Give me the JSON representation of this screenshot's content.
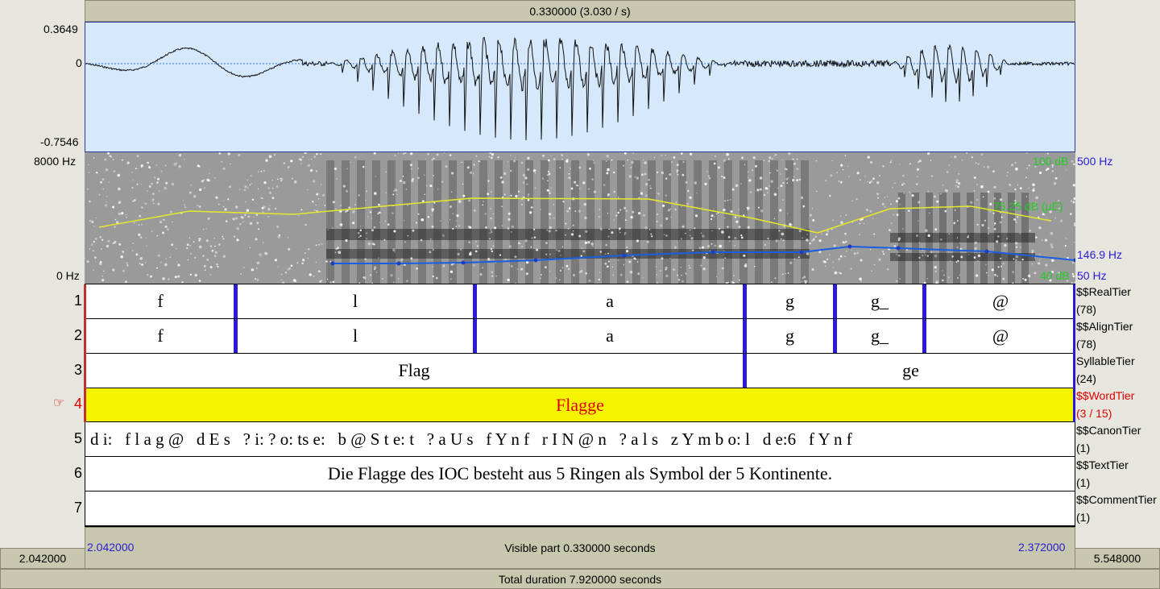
{
  "top_bar": {
    "label": "0.330000 (3.030 / s)"
  },
  "waveform": {
    "max": "0.3649",
    "zero": "0",
    "min": "-0.7546"
  },
  "spectrogram": {
    "freq_top": "8000 Hz",
    "freq_bottom": "0 Hz",
    "intensity_top": "100 dB",
    "intensity_cursor": "75.25 dB (μE)",
    "intensity_bottom": "40 dB",
    "pitch_top": "500 Hz",
    "pitch_cursor": "146.9 Hz",
    "pitch_bottom": "50 Hz"
  },
  "tiers": [
    {
      "num": "1",
      "name": "$$RealTier",
      "count": "(78)",
      "segments": [
        "f",
        "l",
        "a",
        "g",
        "g_",
        "@"
      ]
    },
    {
      "num": "2",
      "name": "$$AlignTier",
      "count": "(78)",
      "segments": [
        "f",
        "l",
        "a",
        "g",
        "g_",
        "@"
      ]
    },
    {
      "num": "3",
      "name": "SyllableTier",
      "count": "(24)",
      "segments": [
        "Flag",
        "ge"
      ]
    },
    {
      "num": "4",
      "pointer": "☞",
      "name": "$$WordTier",
      "count": "(3 / 15)",
      "segments": [
        "Flagge"
      ]
    },
    {
      "num": "5",
      "name": "$$CanonTier",
      "count": "(1)",
      "text": "d i:   f l a g @   d E s   ? i: ? o: ts e:   b @ S t e: t   ? a U s   f Y n f   r I N @ n   ? a l s   z Y m b o: l   d e:6   f Y n f"
    },
    {
      "num": "6",
      "name": "$$TextTier",
      "count": "(1)",
      "text": "Die Flagge des IOC besteht aus 5 Ringen als Symbol der 5 Kontinente."
    },
    {
      "num": "7",
      "name": "$$CommentTier",
      "count": "(1)",
      "text": ""
    }
  ],
  "bottom": {
    "visible_start": "2.042000",
    "visible_end": "2.372000",
    "visible_label": "Visible part 0.330000 seconds",
    "left_value": "2.042000",
    "right_value": "5.548000",
    "total_label": "Total duration 7.920000 seconds"
  },
  "colors": {
    "wave_bg": "#d6e8fb",
    "selection": "#f5f500",
    "boundary": "#2b1bd6",
    "pitch": "#1a5fe0",
    "intensity": "#e8e82a"
  }
}
